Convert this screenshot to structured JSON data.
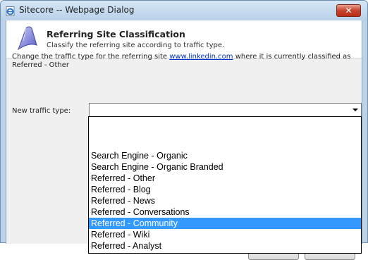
{
  "window": {
    "title": "Sitecore -- Webpage Dialog",
    "close_label": "✕"
  },
  "header": {
    "title": "Referring Site Classification",
    "subtitle": "Classify the referring site according to traffic type."
  },
  "description": {
    "prefix": "Change the traffic type for the referring site ",
    "link": "www.linkedin.com",
    "suffix": " where it is currently classified as Referred - Other"
  },
  "traffic_type": {
    "label": "New traffic type:",
    "value": "",
    "options": [
      "",
      "Search Engine - Organic",
      "Search Engine - Organic Branded",
      "Referred - Other",
      "Referred - Blog",
      "Referred - News",
      "Referred - Conversations",
      "Referred - Community",
      "Referred - Wiki",
      "Referred - Analyst"
    ],
    "highlighted_index": 7
  },
  "icons": {
    "title_icon": "ie-page-icon",
    "header_icon": "classification-icon"
  },
  "colors": {
    "selection": "#3399ff",
    "link": "#0033cc",
    "close_button": "#c7432b"
  }
}
